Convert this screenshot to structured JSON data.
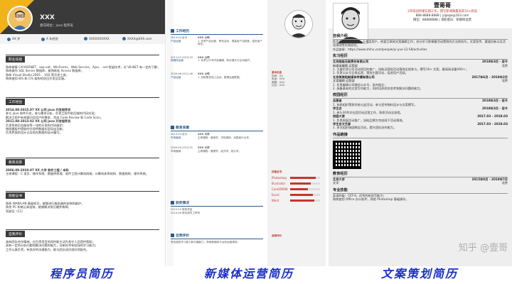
{
  "r1": {
    "name": "XXX",
    "job": "意向岗位：java 程序员",
    "contacts": [
      "XX 岁",
      "X 年经验",
      "XXXXXXXXXX",
      "XXXX@XXX.com"
    ],
    "sections": [
      {
        "title": "职业技能",
        "lines": [
          "熟练掌握 C#/ASP.NET、asp.net、WinForms、Web Service、Ajax、.net 框架技术，对 VB.NET 有一定的了解；",
          "熟练操作 SQL Server 数据库，能熟练处 Access 数据库；",
          "熟练 Visual Studio 2005 、VSS 等开发工具；",
          "熟练使用 B/S 和 C/S 架构的项目开发及实施。"
        ]
      },
      {
        "title": "工作经验",
        "lines": [
          "2014.08-2015.07        XX 公司                java 开发程序员",
          "参与 java 软件开发，参与需求分析，负责工程中前后端的代码实现；",
          "解决工程中有关疑问及用户的需求，完成 Code Review 和 Code Scan。",
          "2011.08-2013.02        XX 公司                java 开发程序员",
          "负责系统后台服务等一块的开发和代码维护；",
          "按照模板中提取的字段将数据实现导出功能；",
          "负责界面的设计以及前台数据的设计编写。"
        ]
      },
      {
        "title": "教育背景",
        "lines": [
          "2006.09-2010.07        XX 大学                软件工程 / 本科",
          "主修课程：C 语言、操作系统、数据库原理、软件工程计算机网络，计算机体系结构、数据结构、操作系统。"
        ]
      },
      {
        "title": "技能证书",
        "lines": [
          "熟练 WAN/LAN 基础知识，能够进行服务器的安装和维护；",
          "熟悉 PC 和笔记本组装，能够解决常见硬件故障；",
          "驾驶证（C1）"
        ]
      },
      {
        "title": "自我评价",
        "lines": [
          "具有团队合作精神，在负责项目的同时能主动为其它人员提供帮助；",
          "具有一定的分析问题和解决问题的能力，对新技术有较强的学习能力；",
          "工作认真负责，有良好的沟通能力，能与团队成员很好地配合。"
        ]
      }
    ]
  },
  "r2": {
    "sections": [
      {
        "title": "工作经历",
        "rows": [
          {
            "date": "2013.04-至今",
            "org": "XXX 公司",
            "role": "产品运营",
            "desc": "1. 负责产品运营，策划活动，提高用户活跃度，促进用户转化。"
          },
          {
            "date": "2011.07-2013.03",
            "org": "XXX 公司",
            "role": "新媒体运营",
            "desc": "1. 负责公众号内容编辑，粉丝增长与互动维护。"
          },
          {
            "date": "2009.06-2011.06",
            "org": "XXX 公司",
            "role": "产品运营",
            "desc": "1. 协助策划线上活动，整理运营数据。"
          }
        ]
      },
      {
        "title": "教育背景",
        "rows": [
          {
            "date": "2013.03-至今",
            "org": "XXX 大学",
            "role": "市场营销",
            "desc": "主修课程：营销学、市场调研、消费者行为学。"
          },
          {
            "date": "2009.09-2013.01",
            "org": "XXX 大学",
            "role": "市场营销",
            "desc": "主修课程：管理学、经济学、统计学。"
          }
        ]
      },
      {
        "title": "获奖情况",
        "rows": [
          {
            "date": "",
            "org": "2015.03 获奖学金",
            "role": "",
            "desc": "2014.06 获优秀员工称号"
          }
        ]
      },
      {
        "title": "自我评价",
        "rows": [
          {
            "date": "",
            "org": "",
            "role": "",
            "desc": "有较强的学习能力和沟通能力，熟悉新媒体平台的运营规则。"
          }
        ]
      }
    ]
  },
  "r3": {
    "sections": [
      "基本信息",
      "技能证书",
      "自我评价"
    ],
    "fields": [
      "年龄：XX",
      "电话：XXX",
      "邮箱：XXX",
      "住址：XXX"
    ],
    "skills": [
      {
        "label": "Photoshop",
        "level": 0.85
      },
      {
        "label": "Illustrator",
        "level": 0.7
      },
      {
        "label": "CorelDRAW",
        "level": 0.6
      },
      {
        "label": "Excel",
        "level": 0.75
      },
      {
        "label": "Word",
        "level": 0.8
      }
    ]
  },
  "r4": {
    "name": "壹哥哥",
    "meta": [
      "2年校园传媒实践工作，撰写新闻稿最高获10+阅读",
      "888-8888-8888  |  yigege@163.com",
      "微信：88888888  |  求职意向：新媒体运营"
    ],
    "intro_title": "自我介绍",
    "intro": "我是壹哥哥，新媒体行业重度用户，热爱互联网文案编辑工作；充分学习和掌握活动策划的方法和技巧，文案宣传、渠道拉新以及活动落地等实践经验。",
    "portfolio": "作品链接：https://www.zhihu.com/people/yi-yue-12-58/activities",
    "exp_title": "实习经历",
    "jobs": [
      {
        "org": "北京超级无敌责任有限公司",
        "date": "2018年3月 - 至今",
        "role": "新媒体编辑 运营部",
        "place": "北京",
        "lines": [
          "1. 主要负责公司活动项目的推广，协助运营组活动落地全程参与，撰写10+ 文案，最高阅读量X00+；",
          "2. 负责公众号日常运营，策划主题活动，促进用户活跃。"
        ]
      },
      {
        "org": "北京美美哒新媒体传播有限公司",
        "date": "2017年6月 - 2018年2月",
        "role": "文案编辑 运营部",
        "place": "北京",
        "lines": [
          "1. 负责编辑公司微信公众号，发布推文；",
          "2. 具备基本的文案写作能力，同时培养综合思考和解决问题的能力。"
        ]
      }
    ],
    "campus_title": "校园经历",
    "campus": [
      {
        "role": "志愿者",
        "date": "2018年3月 - 至今",
        "line": "1. 协助组织策划学校公益活动，参与宣传物料设计与文案撰写。"
      },
      {
        "role": "学生会",
        "date": "2018年3月 - 至今",
        "line": "1. 参与30余次社团活动运营工作，熟悉活动全流程。"
      },
      {
        "role": "校园大使",
        "date": "2017.03 - 2018.03",
        "line": "1. 负责校园活动推广，协助品牌方完成线下活动落地。"
      },
      {
        "role": "学生会文艺部",
        "date": "2017.03 - 2018.03",
        "line": "1. 多次组织校园晚会活动，提升团队协作能力。"
      }
    ],
    "works_title": "作品链接",
    "edu_title": "教育经历",
    "edu": {
      "school": "北京大学",
      "date": "2015年9月 - 2019年7月",
      "major": "文学",
      "place": "北京"
    },
    "skill_title": "专业技能",
    "skills": [
      "英语四级：CET-6，优秀的听说写能力；",
      "熟练使用 Office 办公软件，熟悉 Photoshop 基础操作。"
    ]
  },
  "captions": [
    "程序员简历",
    "新媒体运营简历",
    "文案策划简历"
  ],
  "watermark": "知乎 @壹哥"
}
